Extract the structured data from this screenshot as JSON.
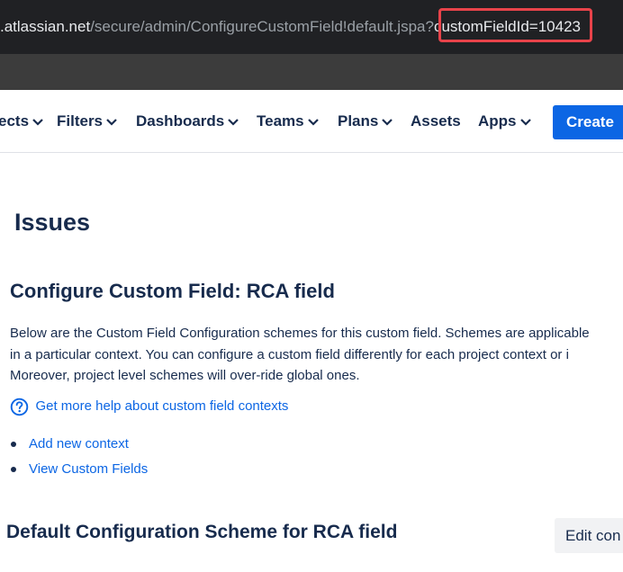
{
  "browser": {
    "url_prefix": ".atlassian.net",
    "url_path": "/secure/admin/ConfigureCustomField!default.jspa?",
    "url_param": "customFieldId=10423",
    "highlight_color": "#e8434a"
  },
  "nav": {
    "projects_label": "ects",
    "filters_label": "Filters",
    "dashboards_label": "Dashboards",
    "teams_label": "Teams",
    "plans_label": "Plans",
    "assets_label": "Assets",
    "apps_label": "Apps",
    "create_label": "Create",
    "accent_color": "#0c66e4"
  },
  "page": {
    "title": "Issues",
    "section_title": "Configure Custom Field: RCA field",
    "description_lines": [
      "Below are the Custom Field Configuration schemes for this custom field. Schemes are applicable",
      "in a particular context. You can configure a custom field differently for each project context or i",
      "Moreover, project level schemes will over-ride global ones."
    ],
    "help_link": "Get more help about custom field contexts",
    "actions": [
      "Add new context",
      "View Custom Fields"
    ],
    "subsection_title": "Default Configuration Scheme for RCA field",
    "edit_button": "Edit con"
  }
}
